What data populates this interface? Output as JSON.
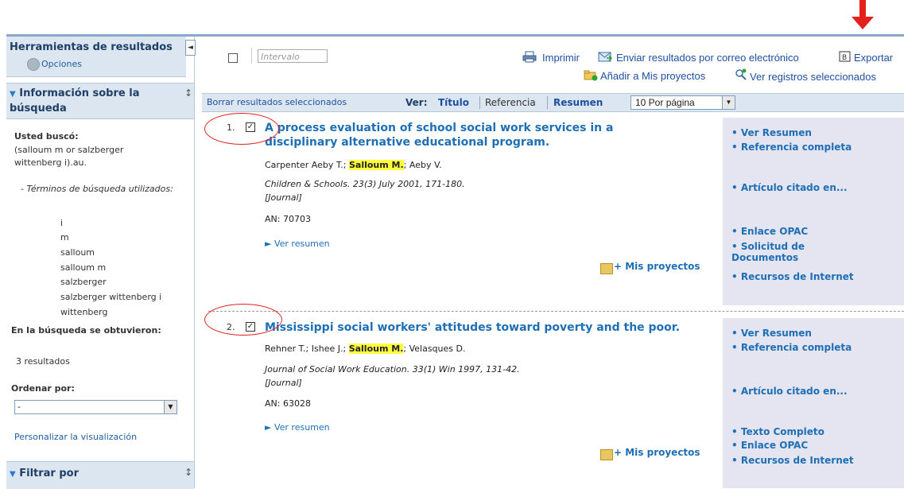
{
  "sidebar": {
    "tools_title": "Herramientas de resultados",
    "collapse_glyph": "◄",
    "options_label": "Opciones",
    "info_title": "Información sobre la búsqueda",
    "you_searched_label": "Usted buscó:",
    "query": "(salloum m or salzberger wittenberg i).au.",
    "terms_label": "- Términos de búsqueda utilizados:",
    "terms": [
      "i",
      "m",
      "salloum",
      "salloum m",
      "salzberger",
      "salzberger wittenberg i",
      "wittenberg"
    ],
    "obtained_label": "En la búsqueda se obtuvieron:",
    "results_count": "3 resultados",
    "sort_label": "Ordenar por:",
    "sort_value": "-",
    "customize_link": "Personalizar la visualización",
    "filter_title": "Filtrar por",
    "resize_glyph": "↕"
  },
  "toolbar": {
    "interval_placeholder": "Intervalo",
    "print": "Imprimir",
    "email": "Enviar resultados por correo electrónico",
    "export": "Exportar",
    "add_projects": "Añadir a Mis proyectos",
    "view_selected": "Ver registros seleccionados"
  },
  "results_header": {
    "clear_selected": "Borrar resultados seleccionados",
    "view_label": "Ver:",
    "view_title": "Título",
    "view_reference": "Referencia",
    "view_summary": "Resumen",
    "per_page": "10 Por página"
  },
  "records": [
    {
      "num": "1.",
      "title_line1": "A process evaluation of school social work services in a",
      "title_line2": "disciplinary alternative educational program.",
      "authors_pre": "Carpenter Aeby T.; ",
      "authors_hl": "Salloum M.",
      "authors_post": "; Aeby V.",
      "source": "Children & Schools. 23(3) July 2001, 171-180.",
      "type": "[Journal]",
      "an": "AN: 70703",
      "ver_resumen": "Ver resumen",
      "mis_proyectos": "+ Mis proyectos",
      "links": [
        "Ver Resumen",
        "Referencia completa",
        "Artículo citado en...",
        "Enlace OPAC",
        "Solicitud de Documentos",
        "Recursos de Internet"
      ]
    },
    {
      "num": "2.",
      "title_line1": "Mississippi social workers' attitudes toward poverty and the poor.",
      "authors_pre": "Rehner T.; Ishee J.; ",
      "authors_hl": "Salloum M.",
      "authors_post": "; Velasques D.",
      "source": "Journal of Social Work Education. 33(1) Win 1997, 131-42.",
      "type": "[Journal]",
      "an": "AN: 63028",
      "ver_resumen": "Ver resumen",
      "mis_proyectos": "+ Mis proyectos",
      "links": [
        "Ver Resumen",
        "Referencia completa",
        "Artículo citado en...",
        "Texto Completo",
        "Enlace OPAC",
        "Recursos de Internet"
      ]
    }
  ],
  "colors": {
    "annotation_red": "#e5201c",
    "link_blue": "#1f6fb5",
    "panel_blue": "#dbe6f1",
    "highlight": "#ffff40"
  }
}
